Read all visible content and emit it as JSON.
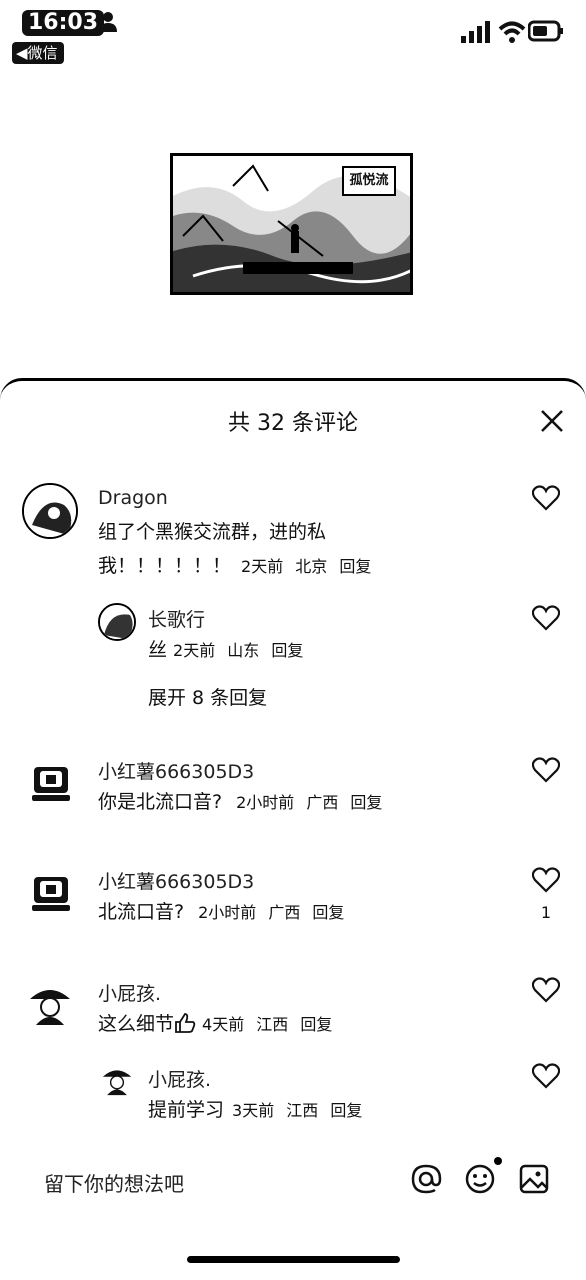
{
  "status_bar": {
    "time": "16:03",
    "back_label": "微信"
  },
  "video": {
    "tag": "孤悦流"
  },
  "comments_panel": {
    "title": "共 32 条评论",
    "comments": [
      {
        "user": "Dragon",
        "text_line1": "组了个黑猴交流群，进的私",
        "text_line2": "我！！！！！！",
        "time": "2天前",
        "location": "北京",
        "reply": "回复"
      },
      {
        "user": "长歌行",
        "text": "丝",
        "time": "2天前",
        "location": "山东",
        "reply": "回复"
      },
      {
        "expand_label": "展开 8 条回复"
      },
      {
        "user": "小红薯666305D3",
        "text": "你是北流口音?",
        "time": "2小时前",
        "location": "广西",
        "reply": "回复"
      },
      {
        "user": "小红薯666305D3",
        "text": "北流口音?",
        "time": "2小时前",
        "location": "广西",
        "reply": "回复",
        "likes": "1"
      },
      {
        "user": "小屁孩.",
        "text": "这么细节",
        "time": "4天前",
        "location": "江西",
        "reply": "回复"
      },
      {
        "user": "小屁孩.",
        "text": "提前学习",
        "time": "3天前",
        "location": "江西",
        "reply": "回复"
      }
    ]
  },
  "input_bar": {
    "placeholder": "留下你的想法吧"
  }
}
